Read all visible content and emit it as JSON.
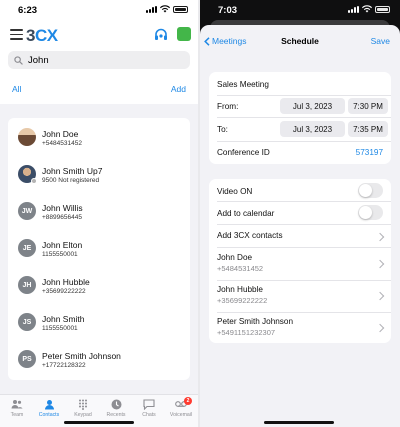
{
  "left": {
    "status_time": "6:23",
    "logo": {
      "text": "3",
      "accent": "CX"
    },
    "search": {
      "value": "John",
      "placeholder": "Search"
    },
    "filters": {
      "all": "All",
      "add": "Add"
    },
    "contacts": [
      {
        "name": "John Doe",
        "number": "+5484531452",
        "avatar": ""
      },
      {
        "name": "John Smith Up7",
        "number": "9500 Not registered",
        "avatar": ""
      },
      {
        "name": "John Willis",
        "number": "+8899656445",
        "avatar": "JW"
      },
      {
        "name": "John Elton",
        "number": "1155550001",
        "avatar": "JE"
      },
      {
        "name": "John Hubble",
        "number": "+35699222222",
        "avatar": "JH"
      },
      {
        "name": "John Smith",
        "number": "1155550001",
        "avatar": "JS"
      },
      {
        "name": "Peter Smith Johnson",
        "number": "+17722128322",
        "avatar": "PS"
      }
    ],
    "tabs": [
      {
        "label": "Team",
        "icon": "team-icon"
      },
      {
        "label": "Contacts",
        "icon": "contacts-icon"
      },
      {
        "label": "Keypad",
        "icon": "keypad-icon"
      },
      {
        "label": "Recents",
        "icon": "recents-icon"
      },
      {
        "label": "Chats",
        "icon": "chats-icon"
      },
      {
        "label": "Voicemail",
        "icon": "voicemail-icon",
        "badge": "2"
      }
    ],
    "colors": {
      "accent": "#1e88e5",
      "presence": "#43b649"
    }
  },
  "right": {
    "status_time": "7:03",
    "nav": {
      "back": "Meetings",
      "title": "Schedule",
      "save": "Save"
    },
    "meeting_name": "Sales Meeting",
    "from": {
      "label": "From:",
      "date": "Jul 3, 2023",
      "time": "7:30 PM"
    },
    "to": {
      "label": "To:",
      "date": "Jul 3, 2023",
      "time": "7:35 PM"
    },
    "conference": {
      "label": "Conference ID",
      "value": "573197"
    },
    "options": {
      "video_label": "Video ON",
      "calendar_label": "Add to calendar",
      "add_contacts_label": "Add 3CX contacts",
      "video_on": false,
      "calendar_on": false
    },
    "participants": [
      {
        "name": "John Doe",
        "number": "+5484531452"
      },
      {
        "name": "John Hubble",
        "number": "+35699222222"
      },
      {
        "name": "Peter Smith Johnson",
        "number": "+5491151232307"
      }
    ]
  }
}
